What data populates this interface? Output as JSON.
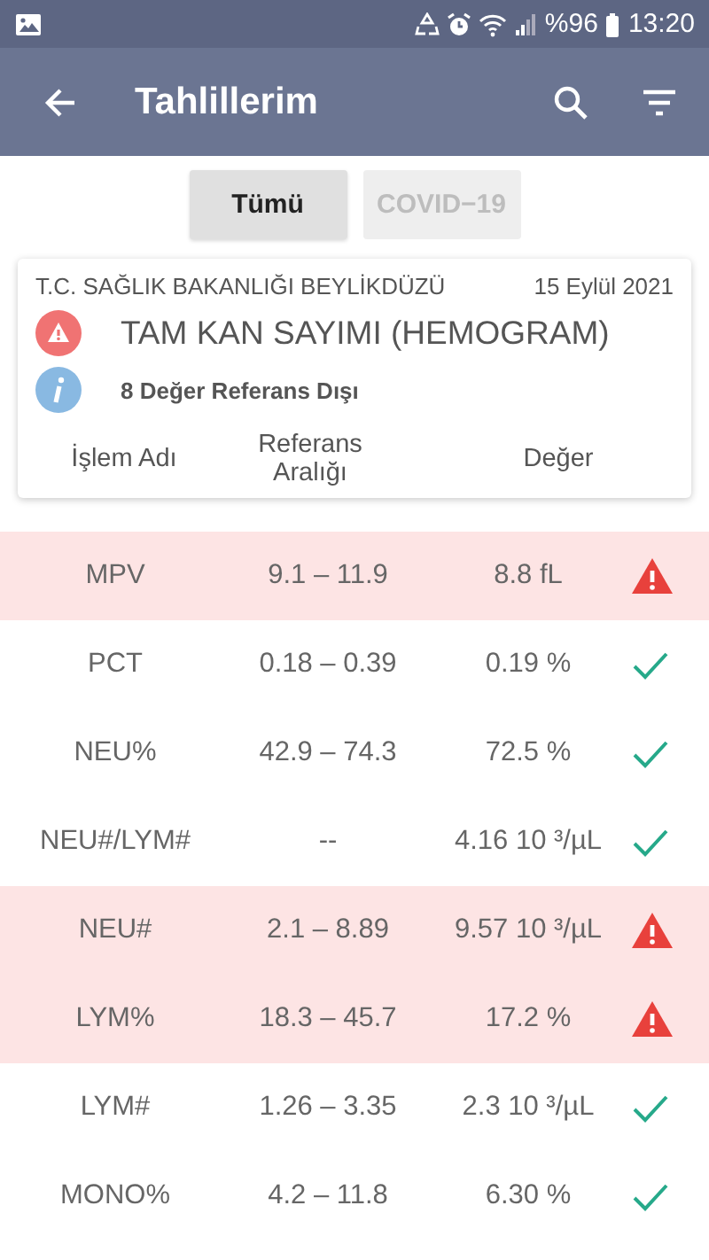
{
  "status_bar": {
    "battery": "%96",
    "time": "13:20"
  },
  "toolbar": {
    "title": "Tahlillerim"
  },
  "tabs": [
    {
      "label": "Tümü",
      "selected": true
    },
    {
      "label": "COVID−19",
      "selected": false
    }
  ],
  "card": {
    "institution": "T.C. SAĞLIK BAKANLIĞI BEYLİKDÜZÜ",
    "date": "15 Eylül 2021",
    "title": "TAM KAN SAYIMI (HEMOGRAM)",
    "summary": "8 Değer Referans Dışı",
    "columns": [
      "İşlem Adı",
      "Referans Aralığı",
      "Değer"
    ]
  },
  "rows": [
    {
      "name": "MPV",
      "range": "9.1 – 11.9",
      "value": "8.8 fL",
      "out_of_range": true
    },
    {
      "name": "PCT",
      "range": "0.18 – 0.39",
      "value": "0.19 %",
      "out_of_range": false
    },
    {
      "name": "NEU%",
      "range": "42.9 – 74.3",
      "value": "72.5 %",
      "out_of_range": false
    },
    {
      "name": "NEU#/LYM#",
      "range": "--",
      "value": "4.16 10 ³/µL",
      "out_of_range": false
    },
    {
      "name": "NEU#",
      "range": "2.1 – 8.89",
      "value": "9.57 10 ³/µL",
      "out_of_range": true
    },
    {
      "name": "LYM%",
      "range": "18.3 – 45.7",
      "value": "17.2 %",
      "out_of_range": true
    },
    {
      "name": "LYM#",
      "range": "1.26 – 3.35",
      "value": "2.3 10 ³/µL",
      "out_of_range": false
    },
    {
      "name": "MONO%",
      "range": "4.2 – 11.8",
      "value": "6.30 %",
      "out_of_range": false
    }
  ]
}
